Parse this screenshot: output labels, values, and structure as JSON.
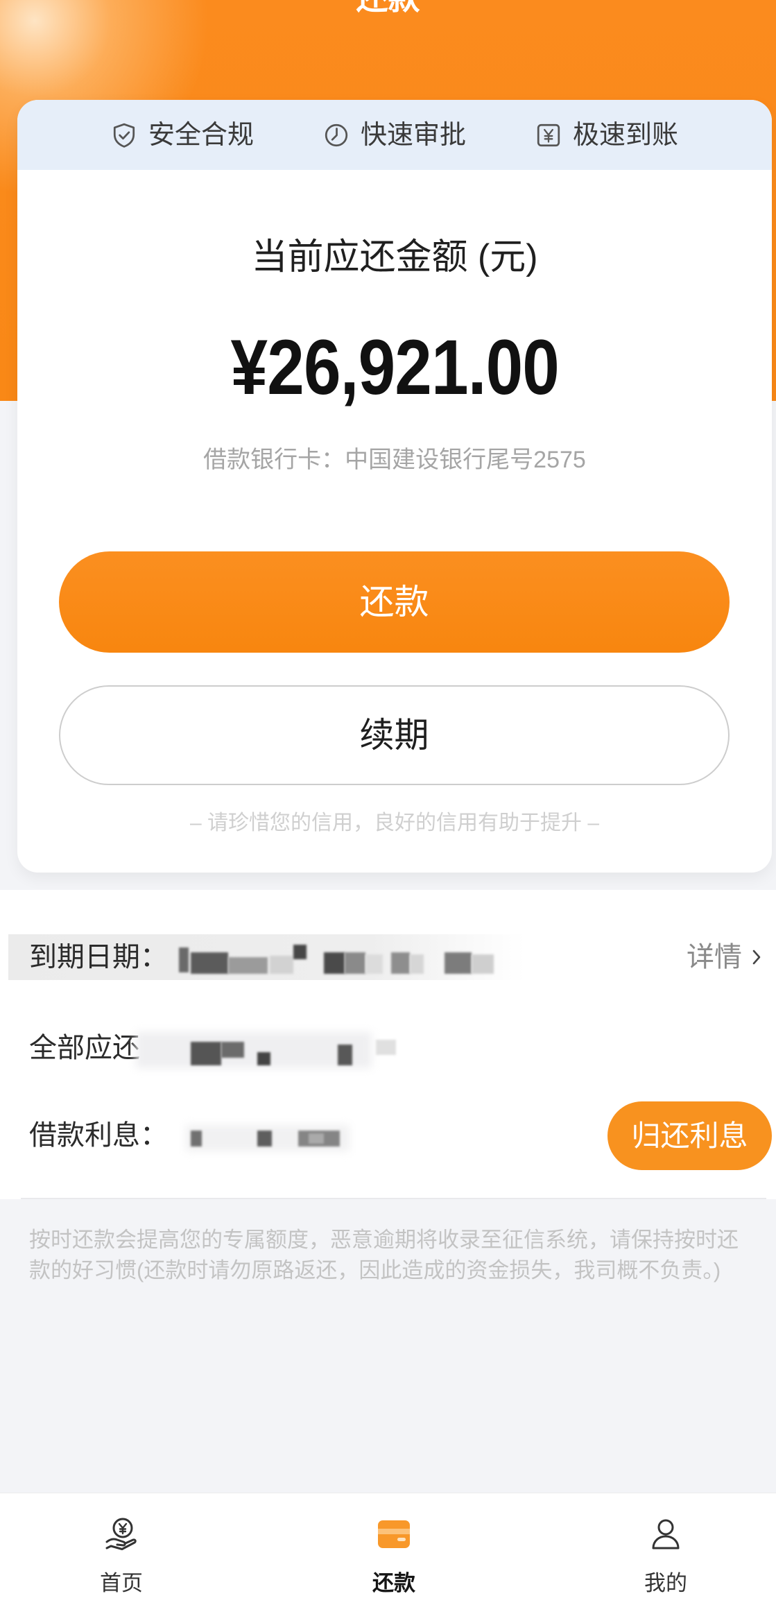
{
  "header": {
    "title": "还款"
  },
  "features": [
    {
      "icon": "shield-check-icon",
      "label": "安全合规"
    },
    {
      "icon": "clock-icon",
      "label": "快速审批"
    },
    {
      "icon": "yen-square-icon",
      "label": "极速到账"
    }
  ],
  "amount_card": {
    "title": "当前应还金额 (元)",
    "amount": "¥26,921.00",
    "bank_card": "借款银行卡：中国建设银行尾号2575",
    "repay_button": "还款",
    "renew_button": "续期",
    "credit_note": "– 请珍惜您的信用，良好的信用有助于提升 –"
  },
  "details": {
    "due_date_label": "到期日期：",
    "detail_link": "详情",
    "total_due_label": "全部应还",
    "interest_label": "借款利息：",
    "repay_interest_button": "归还利息"
  },
  "notice": "按时还款会提高您的专属额度，恶意逾期将收录至征信系统，请保持按时还款的好习惯(还款时请勿原路返还，因此造成的资金损失，我司概不负责。)",
  "tabbar": [
    {
      "label": "首页",
      "icon": "hand-coin-icon",
      "active": false
    },
    {
      "label": "还款",
      "icon": "wallet-icon",
      "active": true
    },
    {
      "label": "我的",
      "icon": "person-icon",
      "active": false
    }
  ],
  "colors": {
    "accent": "#f98816",
    "feature_strip": "#e6eef9",
    "page_background": "#f3f4f7"
  }
}
